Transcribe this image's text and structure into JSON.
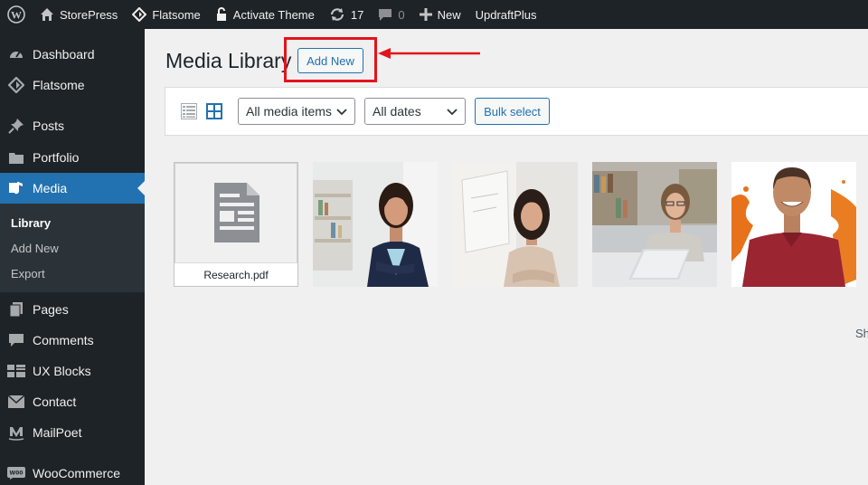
{
  "adminbar": {
    "site": "StorePress",
    "theme": "Flatsome",
    "activate": "Activate Theme",
    "updates": "17",
    "comments": "0",
    "new": "New",
    "updraft": "UpdraftPlus"
  },
  "sidebar": {
    "items": [
      {
        "label": "Dashboard",
        "icon": "dashboard-icon"
      },
      {
        "label": "Flatsome",
        "icon": "flatsome-icon"
      },
      {
        "label": "Posts",
        "icon": "pin-icon"
      },
      {
        "label": "Portfolio",
        "icon": "portfolio-icon"
      },
      {
        "label": "Media",
        "icon": "media-icon",
        "current": true
      },
      {
        "label": "Pages",
        "icon": "pages-icon"
      },
      {
        "label": "Comments",
        "icon": "comments-icon"
      },
      {
        "label": "UX Blocks",
        "icon": "ux-blocks-icon"
      },
      {
        "label": "Contact",
        "icon": "mail-icon"
      },
      {
        "label": "MailPoet",
        "icon": "mailpoet-icon"
      },
      {
        "label": "WooCommerce",
        "icon": "woo-icon"
      }
    ],
    "submenu": [
      "Library",
      "Add New",
      "Export"
    ]
  },
  "main": {
    "title": "Media Library",
    "add_new": "Add New",
    "filter_type": "All media items",
    "filter_date": "All dates",
    "bulk_select": "Bulk select",
    "file_name": "Research.pdf",
    "cut_text": "Sh"
  },
  "colors": {
    "accent": "#2271b1",
    "highlight": "#e3141b",
    "sidebar_bg": "#1d2327"
  }
}
